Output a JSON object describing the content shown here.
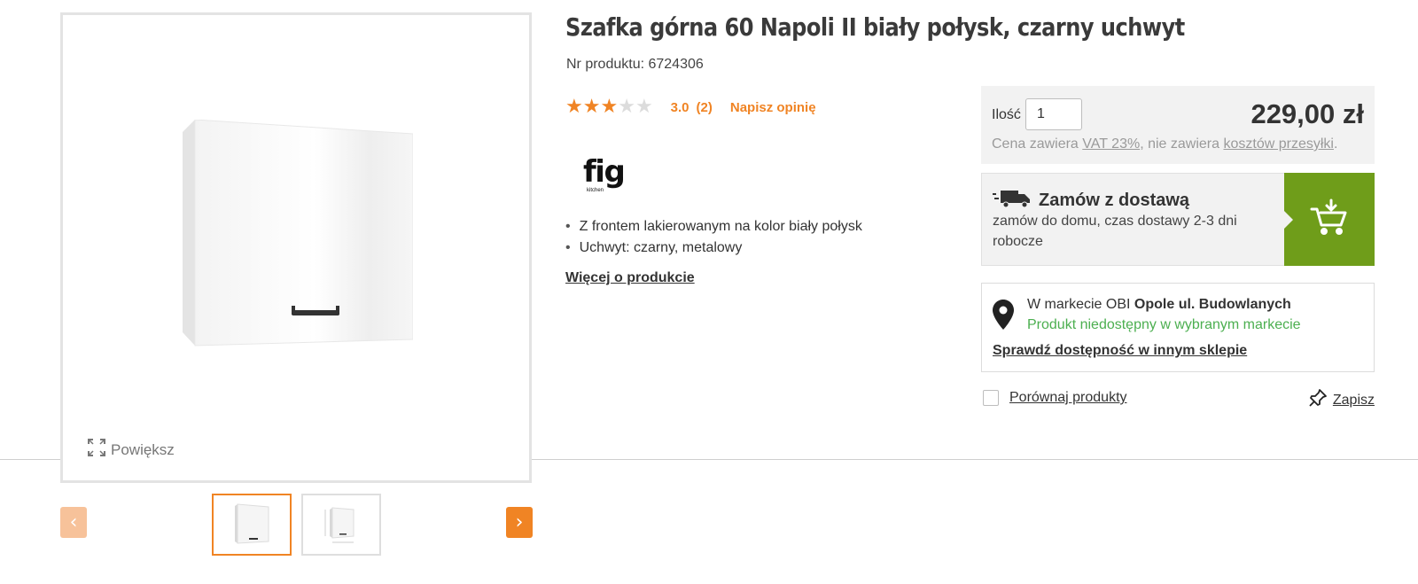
{
  "product": {
    "title": "Szafka górna 60 Napoli II biały połysk, czarny uchwyt",
    "number_text": "Nr produktu: 6724306",
    "rating": {
      "stars_filled": 3,
      "stars_total": 5,
      "score": "3.0",
      "count": "(2)",
      "write_review": "Napisz opinię"
    },
    "brand": {
      "name": "fig",
      "sub": "kitchen"
    },
    "features": [
      "Z frontem lakierowanym na kolor biały połysk",
      "Uchwyt: czarny, metalowy"
    ],
    "more_link": "Więcej o produkcie"
  },
  "gallery": {
    "zoom_label": "Powiększ",
    "prev_arrow": "‹",
    "next_arrow": "›",
    "active_thumb": 1
  },
  "buy_box": {
    "qty_label": "Ilość",
    "qty_value": "1",
    "price": "229,00 zł",
    "price_note_prefix": "Cena zawiera ",
    "price_note_vat": "VAT 23%",
    "price_note_mid": ", nie zawiera ",
    "price_note_shipping": "kosztów przesyłki",
    "price_note_suffix": "."
  },
  "delivery": {
    "title": "Zamów z dostawą",
    "description": "zamów do domu, czas dostawy 2-3 dni robocze"
  },
  "store": {
    "prefix": "W markecie OBI ",
    "name": "Opole ul. Budowlanych",
    "status": "Produkt niedostępny w wybranym markecie",
    "check_link": "Sprawdź dostępność w innym sklepie"
  },
  "actions": {
    "compare_label": "Porównaj produkty",
    "save_label": "Zapisz"
  },
  "colors": {
    "accent": "#f08424",
    "cart_green": "#6f9d1a",
    "availability_green": "#4caf50"
  }
}
